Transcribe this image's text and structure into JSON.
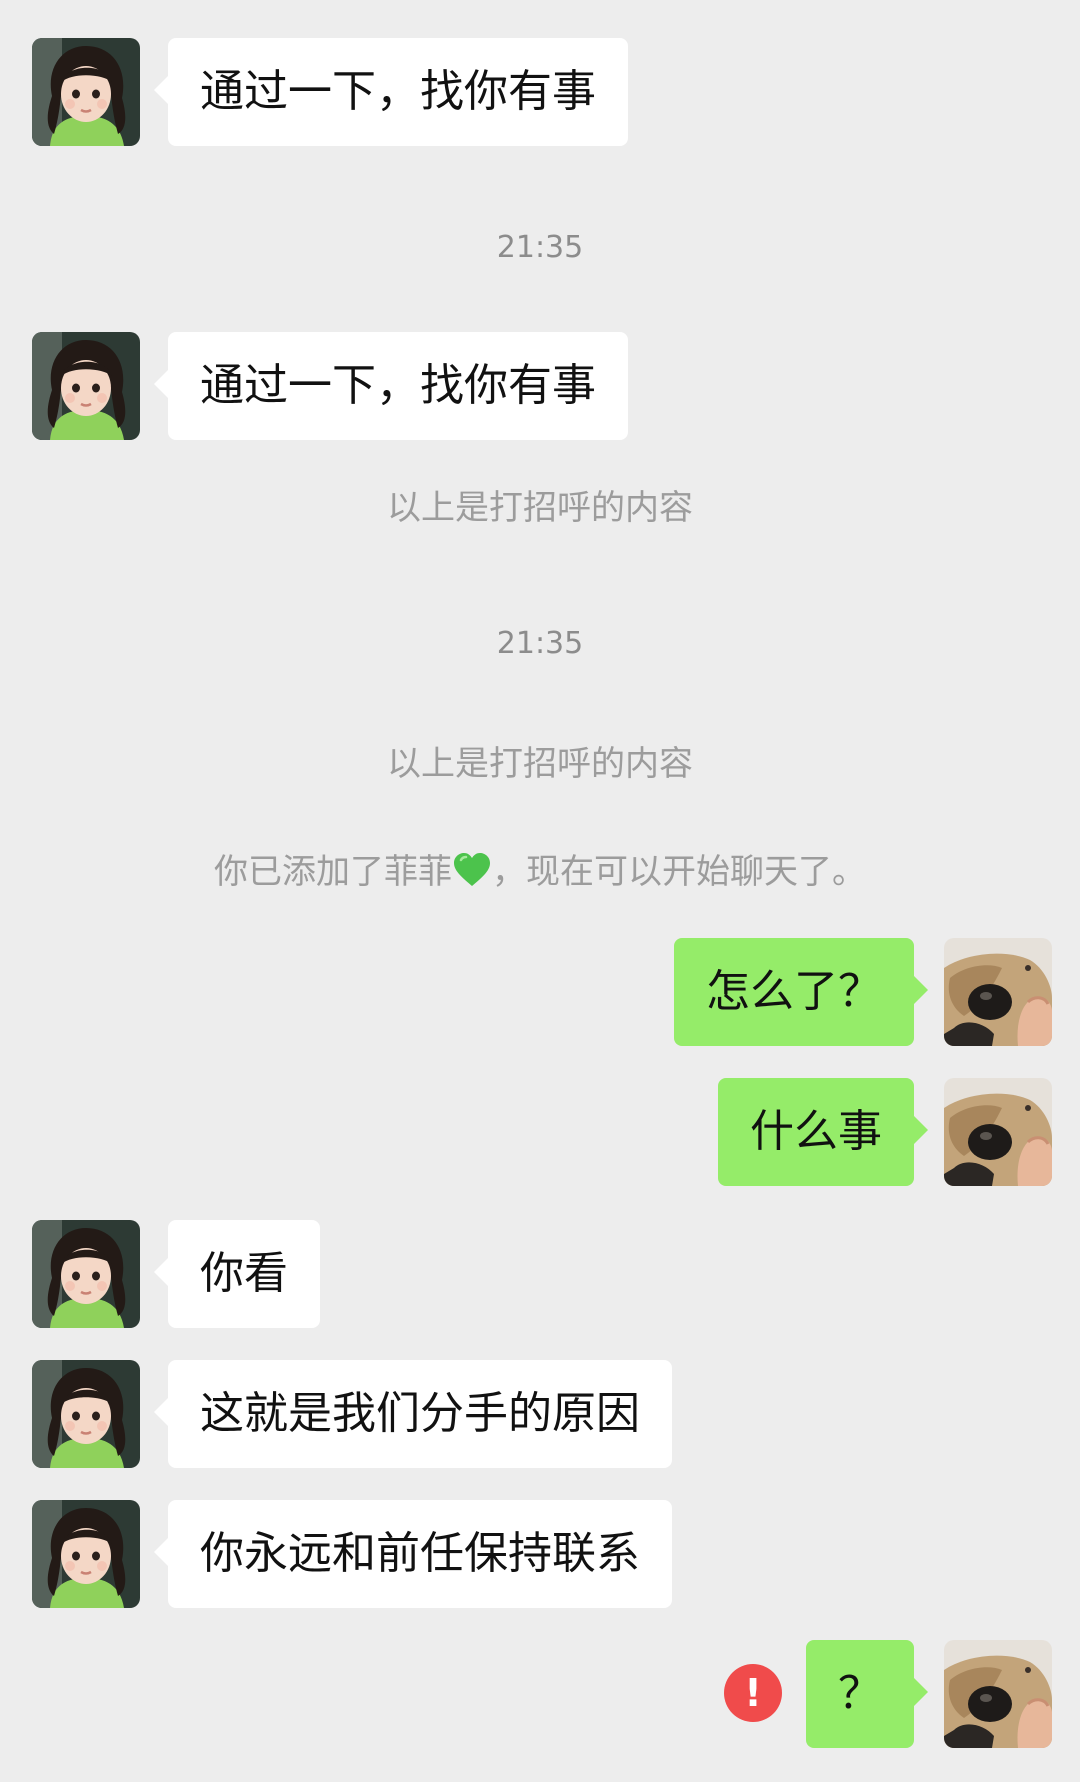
{
  "messages": [
    {
      "side": "left",
      "text": "通过一下，找你有事"
    },
    {
      "side": "left",
      "text": "通过一下，找你有事"
    },
    {
      "side": "right",
      "text": "怎么了？"
    },
    {
      "side": "right",
      "text": "什么事"
    },
    {
      "side": "left",
      "text": "你看"
    },
    {
      "side": "left",
      "text": "这就是我们分手的原因"
    },
    {
      "side": "left",
      "text": "你永远和前任保持联系"
    },
    {
      "side": "right",
      "text": "？",
      "failed": true
    }
  ],
  "system": {
    "time_1": "21:35",
    "greeting_note_1": "以上是打招呼的内容",
    "time_2": "21:35",
    "greeting_note_2": "以上是打招呼的内容",
    "added_note_prefix": "你已添加了菲菲",
    "added_note_suffix": "，现在可以开始聊天了。"
  },
  "icons": {
    "heart": "green-heart-emoji",
    "failed": "send-failed-exclamation-icon"
  },
  "colors": {
    "background": "#ededed",
    "incoming_bubble": "#ffffff",
    "outgoing_bubble": "#95ec69",
    "heart": "#4cc34c",
    "failed_icon": "#f04b4b",
    "system_text": "#9c9c9c"
  }
}
